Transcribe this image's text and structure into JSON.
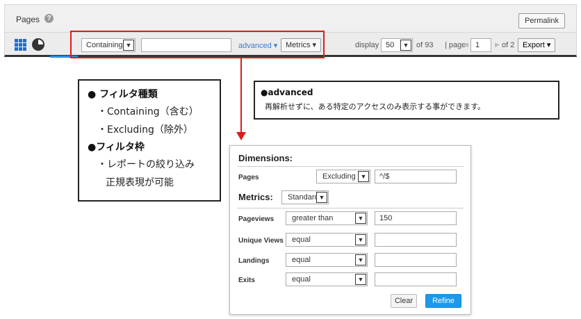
{
  "header": {
    "title": "Pages",
    "help_icon": "question-circle-icon",
    "permalink_label": "Permalink"
  },
  "toolbar": {
    "grid_icon": "grid-view-icon",
    "pie_icon": "pie-chart-icon",
    "filter_type_value": "Containing",
    "filter_input_value": "",
    "advanced_label": "advanced ▾",
    "metrics_label": "Metrics ▾",
    "display_label": "display",
    "display_value": "50",
    "of_count": "of 93",
    "page_label": "| page",
    "prev_arrow": "◀",
    "page_value": "1",
    "next_arrow": "▶",
    "of_pages": "of 2",
    "export_label": "Export ▾",
    "dropdown_arrow": "▼"
  },
  "note_left": {
    "heading1": "● フィルタ種類",
    "item1": "・Containing（含む）",
    "item2": "・Excluding（除外）",
    "heading2": "●フィルタ枠",
    "item3": "・レポートの絞り込み",
    "item4": "正規表現が可能"
  },
  "note_right": {
    "heading": "●advanced",
    "text": "再解析せずに、ある特定のアクセスのみ表示する事ができます。"
  },
  "panel": {
    "dimensions_heading": "Dimensions:",
    "pages_label": "Pages",
    "pages_select": "Excluding",
    "pages_input": "^/$",
    "metrics_heading": "Metrics:",
    "metrics_select": "Standard",
    "rows": [
      {
        "label": "Pageviews",
        "op": "greater than",
        "value": "150"
      },
      {
        "label": "Unique Views",
        "op": "equal",
        "value": ""
      },
      {
        "label": "Landings",
        "op": "equal",
        "value": ""
      },
      {
        "label": "Exits",
        "op": "equal",
        "value": ""
      }
    ],
    "clear_label": "Clear",
    "refine_label": "Refine"
  },
  "colors": {
    "highlight": "#e01919",
    "accent": "#1e98e8",
    "link": "#3a7bd5"
  }
}
